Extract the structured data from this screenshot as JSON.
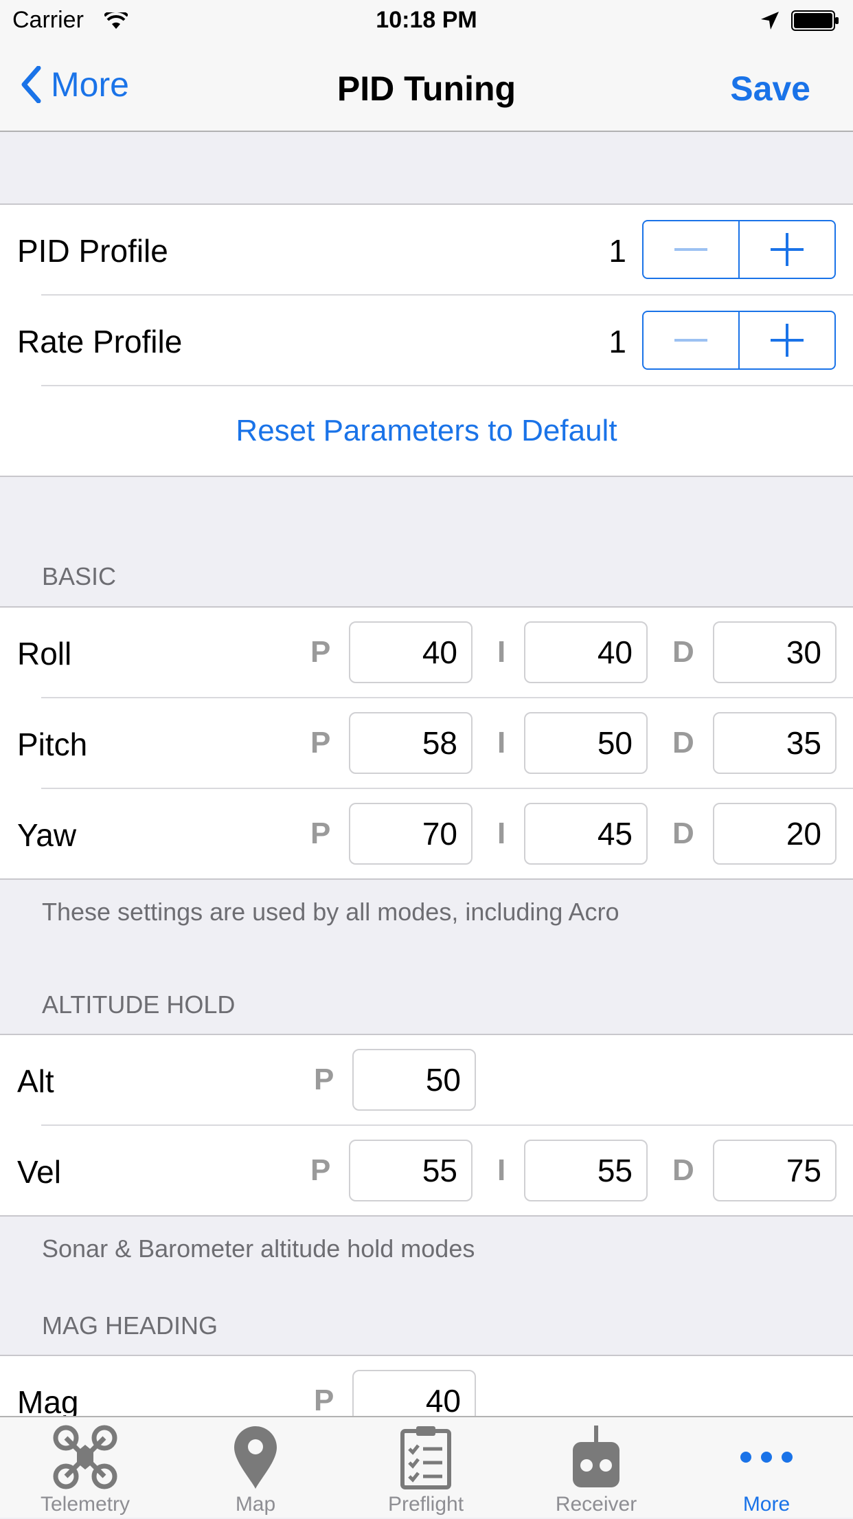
{
  "status": {
    "carrier": "Carrier",
    "time": "10:18 PM"
  },
  "nav": {
    "back_label": "More",
    "title": "PID Tuning",
    "save_label": "Save"
  },
  "profiles": {
    "pid_profile": {
      "label": "PID Profile",
      "value": "1"
    },
    "rate_profile": {
      "label": "Rate Profile",
      "value": "1"
    },
    "reset_label": "Reset Parameters to Default"
  },
  "basic": {
    "header": "BASIC",
    "footer": "These settings are used by all modes, including Acro",
    "rows": [
      {
        "label": "Roll",
        "p": "40",
        "i": "40",
        "d": "30"
      },
      {
        "label": "Pitch",
        "p": "58",
        "i": "50",
        "d": "35"
      },
      {
        "label": "Yaw",
        "p": "70",
        "i": "45",
        "d": "20"
      }
    ]
  },
  "altitude": {
    "header": "ALTITUDE HOLD",
    "footer": "Sonar & Barometer altitude hold modes",
    "alt": {
      "label": "Alt",
      "p": "50"
    },
    "vel": {
      "label": "Vel",
      "p": "55",
      "i": "55",
      "d": "75"
    }
  },
  "mag": {
    "header": "MAG HEADING",
    "row": {
      "label": "Mag",
      "p": "40"
    }
  },
  "letters": {
    "p": "P",
    "i": "I",
    "d": "D"
  },
  "tabs": [
    {
      "label": "Telemetry",
      "icon": "drone-icon"
    },
    {
      "label": "Map",
      "icon": "map-pin-icon"
    },
    {
      "label": "Preflight",
      "icon": "clipboard-icon"
    },
    {
      "label": "Receiver",
      "icon": "receiver-icon"
    },
    {
      "label": "More",
      "icon": "more-icon",
      "active": true
    }
  ],
  "colors": {
    "accent": "#1a73e8",
    "background": "#efeff4"
  }
}
